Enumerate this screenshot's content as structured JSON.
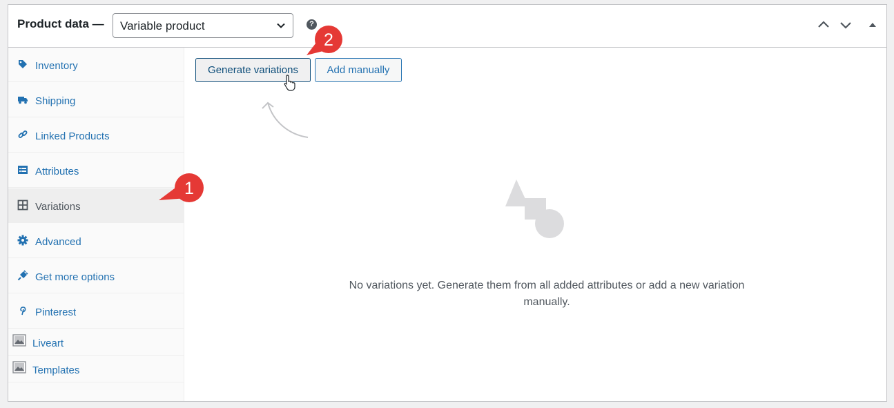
{
  "header": {
    "title": "Product data —",
    "product_type": "Variable product"
  },
  "sidebar": {
    "items": [
      {
        "label": "Inventory",
        "icon": "tag-icon"
      },
      {
        "label": "Shipping",
        "icon": "truck-icon"
      },
      {
        "label": "Linked Products",
        "icon": "link-icon"
      },
      {
        "label": "Attributes",
        "icon": "list-icon"
      },
      {
        "label": "Variations",
        "icon": "grid-icon"
      },
      {
        "label": "Advanced",
        "icon": "gear-icon"
      },
      {
        "label": "Get more options",
        "icon": "plug-icon"
      },
      {
        "label": "Pinterest",
        "icon": "pinterest-icon"
      },
      {
        "label": "Liveart",
        "icon": "image-icon"
      },
      {
        "label": "Templates",
        "icon": "image-icon"
      }
    ],
    "active": "Variations"
  },
  "main": {
    "generate_label": "Generate variations",
    "add_manually_label": "Add manually",
    "empty_line1": "No variations yet. Generate them from all added attributes or add a new variation",
    "empty_line2": "manually."
  },
  "callouts": {
    "first": "1",
    "second": "2"
  },
  "colors": {
    "accent": "#2271b1",
    "callout": "#e53935"
  }
}
